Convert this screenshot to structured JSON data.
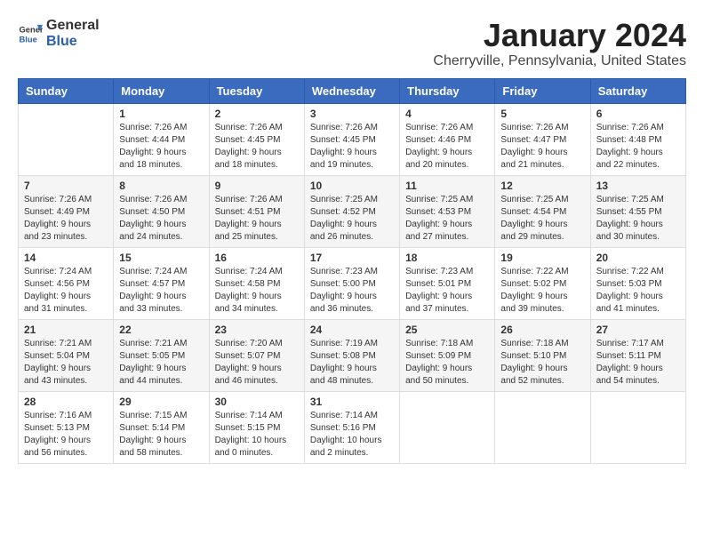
{
  "header": {
    "logo_general": "General",
    "logo_blue": "Blue",
    "month": "January 2024",
    "location": "Cherryville, Pennsylvania, United States"
  },
  "days_of_week": [
    "Sunday",
    "Monday",
    "Tuesday",
    "Wednesday",
    "Thursday",
    "Friday",
    "Saturday"
  ],
  "weeks": [
    [
      {
        "day": "",
        "info": ""
      },
      {
        "day": "1",
        "info": "Sunrise: 7:26 AM\nSunset: 4:44 PM\nDaylight: 9 hours\nand 18 minutes."
      },
      {
        "day": "2",
        "info": "Sunrise: 7:26 AM\nSunset: 4:45 PM\nDaylight: 9 hours\nand 18 minutes."
      },
      {
        "day": "3",
        "info": "Sunrise: 7:26 AM\nSunset: 4:45 PM\nDaylight: 9 hours\nand 19 minutes."
      },
      {
        "day": "4",
        "info": "Sunrise: 7:26 AM\nSunset: 4:46 PM\nDaylight: 9 hours\nand 20 minutes."
      },
      {
        "day": "5",
        "info": "Sunrise: 7:26 AM\nSunset: 4:47 PM\nDaylight: 9 hours\nand 21 minutes."
      },
      {
        "day": "6",
        "info": "Sunrise: 7:26 AM\nSunset: 4:48 PM\nDaylight: 9 hours\nand 22 minutes."
      }
    ],
    [
      {
        "day": "7",
        "info": "Sunrise: 7:26 AM\nSunset: 4:49 PM\nDaylight: 9 hours\nand 23 minutes."
      },
      {
        "day": "8",
        "info": "Sunrise: 7:26 AM\nSunset: 4:50 PM\nDaylight: 9 hours\nand 24 minutes."
      },
      {
        "day": "9",
        "info": "Sunrise: 7:26 AM\nSunset: 4:51 PM\nDaylight: 9 hours\nand 25 minutes."
      },
      {
        "day": "10",
        "info": "Sunrise: 7:25 AM\nSunset: 4:52 PM\nDaylight: 9 hours\nand 26 minutes."
      },
      {
        "day": "11",
        "info": "Sunrise: 7:25 AM\nSunset: 4:53 PM\nDaylight: 9 hours\nand 27 minutes."
      },
      {
        "day": "12",
        "info": "Sunrise: 7:25 AM\nSunset: 4:54 PM\nDaylight: 9 hours\nand 29 minutes."
      },
      {
        "day": "13",
        "info": "Sunrise: 7:25 AM\nSunset: 4:55 PM\nDaylight: 9 hours\nand 30 minutes."
      }
    ],
    [
      {
        "day": "14",
        "info": "Sunrise: 7:24 AM\nSunset: 4:56 PM\nDaylight: 9 hours\nand 31 minutes."
      },
      {
        "day": "15",
        "info": "Sunrise: 7:24 AM\nSunset: 4:57 PM\nDaylight: 9 hours\nand 33 minutes."
      },
      {
        "day": "16",
        "info": "Sunrise: 7:24 AM\nSunset: 4:58 PM\nDaylight: 9 hours\nand 34 minutes."
      },
      {
        "day": "17",
        "info": "Sunrise: 7:23 AM\nSunset: 5:00 PM\nDaylight: 9 hours\nand 36 minutes."
      },
      {
        "day": "18",
        "info": "Sunrise: 7:23 AM\nSunset: 5:01 PM\nDaylight: 9 hours\nand 37 minutes."
      },
      {
        "day": "19",
        "info": "Sunrise: 7:22 AM\nSunset: 5:02 PM\nDaylight: 9 hours\nand 39 minutes."
      },
      {
        "day": "20",
        "info": "Sunrise: 7:22 AM\nSunset: 5:03 PM\nDaylight: 9 hours\nand 41 minutes."
      }
    ],
    [
      {
        "day": "21",
        "info": "Sunrise: 7:21 AM\nSunset: 5:04 PM\nDaylight: 9 hours\nand 43 minutes."
      },
      {
        "day": "22",
        "info": "Sunrise: 7:21 AM\nSunset: 5:05 PM\nDaylight: 9 hours\nand 44 minutes."
      },
      {
        "day": "23",
        "info": "Sunrise: 7:20 AM\nSunset: 5:07 PM\nDaylight: 9 hours\nand 46 minutes."
      },
      {
        "day": "24",
        "info": "Sunrise: 7:19 AM\nSunset: 5:08 PM\nDaylight: 9 hours\nand 48 minutes."
      },
      {
        "day": "25",
        "info": "Sunrise: 7:18 AM\nSunset: 5:09 PM\nDaylight: 9 hours\nand 50 minutes."
      },
      {
        "day": "26",
        "info": "Sunrise: 7:18 AM\nSunset: 5:10 PM\nDaylight: 9 hours\nand 52 minutes."
      },
      {
        "day": "27",
        "info": "Sunrise: 7:17 AM\nSunset: 5:11 PM\nDaylight: 9 hours\nand 54 minutes."
      }
    ],
    [
      {
        "day": "28",
        "info": "Sunrise: 7:16 AM\nSunset: 5:13 PM\nDaylight: 9 hours\nand 56 minutes."
      },
      {
        "day": "29",
        "info": "Sunrise: 7:15 AM\nSunset: 5:14 PM\nDaylight: 9 hours\nand 58 minutes."
      },
      {
        "day": "30",
        "info": "Sunrise: 7:14 AM\nSunset: 5:15 PM\nDaylight: 10 hours\nand 0 minutes."
      },
      {
        "day": "31",
        "info": "Sunrise: 7:14 AM\nSunset: 5:16 PM\nDaylight: 10 hours\nand 2 minutes."
      },
      {
        "day": "",
        "info": ""
      },
      {
        "day": "",
        "info": ""
      },
      {
        "day": "",
        "info": ""
      }
    ]
  ]
}
